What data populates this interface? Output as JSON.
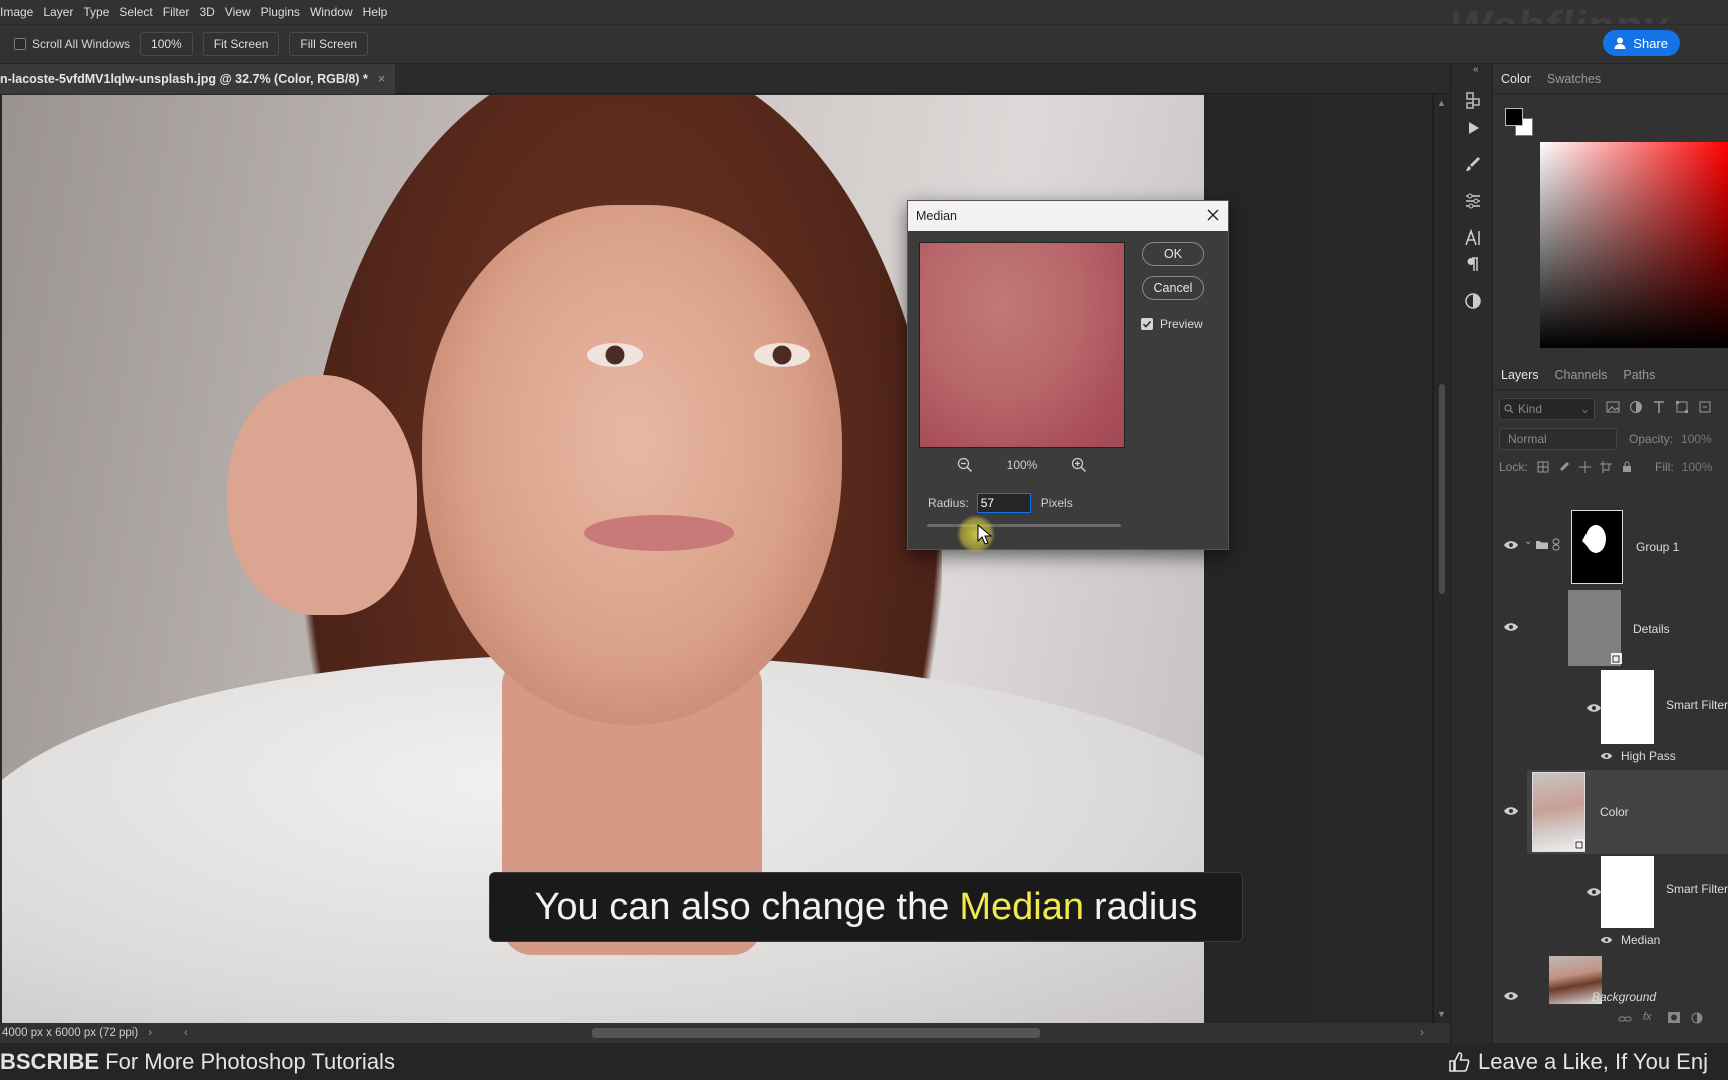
{
  "menubar": {
    "items": [
      "Image",
      "Layer",
      "Type",
      "Select",
      "Filter",
      "3D",
      "View",
      "Plugins",
      "Window",
      "Help"
    ]
  },
  "watermark": "Webflippy",
  "options_bar": {
    "scroll_all_windows": "Scroll All Windows",
    "zoom_100": "100%",
    "fit_screen": "Fit Screen",
    "fill_screen": "Fill Screen"
  },
  "share_button": "Share",
  "document_tab": {
    "title": "n-lacoste-5vfdMV1lqlw-unsplash.jpg @ 32.7% (Color, RGB/8) *",
    "close": "×"
  },
  "median_dialog": {
    "title": "Median",
    "ok": "OK",
    "cancel": "Cancel",
    "preview_label": "Preview",
    "preview_checked": true,
    "zoom_percent": "100%",
    "radius_label": "Radius:",
    "radius_value": "57",
    "radius_unit": "Pixels"
  },
  "subtitle": {
    "before": "You can also change the",
    "highlight": "Median",
    "after": "radius",
    "highlight_color": "#f2e94e"
  },
  "status_bar": {
    "doc_info": "4000 px x 6000 px (72 ppi)"
  },
  "bottom_banner": {
    "left_bold": "BSCRIBE",
    "left_rest": "For More Photoshop Tutorials",
    "right": "Leave a Like, If You Enj"
  },
  "color_panel": {
    "tabs": [
      "Color",
      "Swatches"
    ]
  },
  "layers_panel": {
    "tabs": [
      "Layers",
      "Channels",
      "Paths"
    ],
    "search_placeholder": "Kind",
    "blend_mode": "Normal",
    "opacity_label": "Opacity:",
    "opacity_value": "100%",
    "lock_label": "Lock:",
    "fill_label": "Fill:",
    "fill_value": "100%",
    "layers": [
      {
        "name": "Group 1"
      },
      {
        "name": "Details"
      },
      {
        "name": "Smart Filter"
      },
      {
        "name": "High Pass"
      },
      {
        "name": "Color"
      },
      {
        "name": "Smart Filter"
      },
      {
        "name": "Median"
      },
      {
        "name": "Background"
      }
    ]
  },
  "colors": {
    "accent": "#1473e6",
    "panel_bg": "#323232",
    "dialog_bg": "#3c3c3c"
  }
}
